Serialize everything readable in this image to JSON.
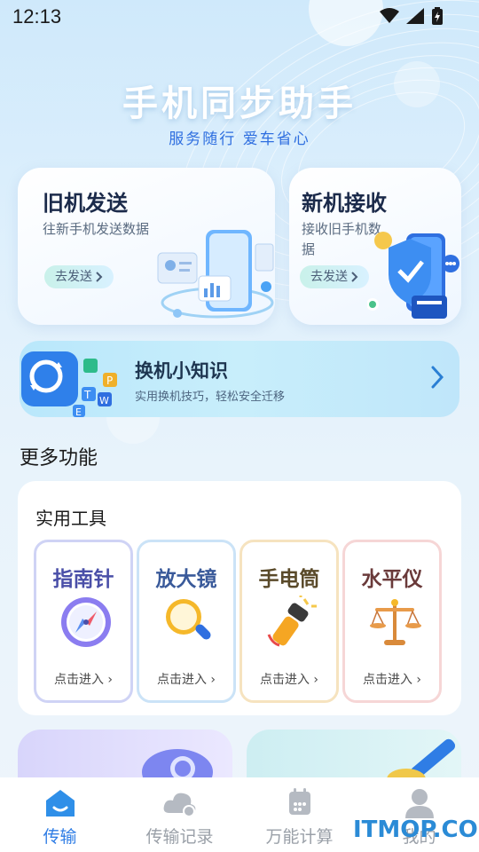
{
  "status_bar": {
    "time": "12:13"
  },
  "hero": {
    "title": "手机同步助手",
    "subtitle": "服务随行  爱车省心"
  },
  "cards": {
    "old_phone": {
      "title": "旧机发送",
      "desc": "往新手机发送数据",
      "button": "去发送"
    },
    "new_phone": {
      "title": "新机接收",
      "desc": "接收旧手机数据",
      "button": "去发送"
    }
  },
  "banner": {
    "title": "换机小知识",
    "subtitle": "实用换机技巧，轻松安全迁移"
  },
  "more": {
    "title": "更多功能"
  },
  "tools": {
    "title": "实用工具",
    "items": [
      {
        "name": "指南针",
        "enter": "点击进入",
        "color": "#4a4fa8",
        "border": "#cfd3f5",
        "icon": "compass-icon"
      },
      {
        "name": "放大镜",
        "enter": "点击进入",
        "color": "#3a5a9a",
        "border": "#cbe3f7",
        "icon": "magnifier-icon"
      },
      {
        "name": "手电筒",
        "enter": "点击进入",
        "color": "#5a4a2a",
        "border": "#f6e3bf",
        "icon": "flashlight-icon"
      },
      {
        "name": "水平仪",
        "enter": "点击进入",
        "color": "#6a3a3a",
        "border": "#f6d6d6",
        "icon": "scale-icon"
      }
    ]
  },
  "tabbar": {
    "items": [
      {
        "label": "传输",
        "active": true,
        "icon": "home-icon"
      },
      {
        "label": "传输记录",
        "active": false,
        "icon": "cloud-icon"
      },
      {
        "label": "万能计算",
        "active": false,
        "icon": "calendar-icon"
      },
      {
        "label": "我的",
        "active": false,
        "icon": "user-icon"
      }
    ]
  },
  "watermark": {
    "it": "ITMOP",
    "com": ".COM"
  },
  "colors": {
    "accent": "#2f7de5",
    "hero_subtitle": "#2f6fe0"
  }
}
